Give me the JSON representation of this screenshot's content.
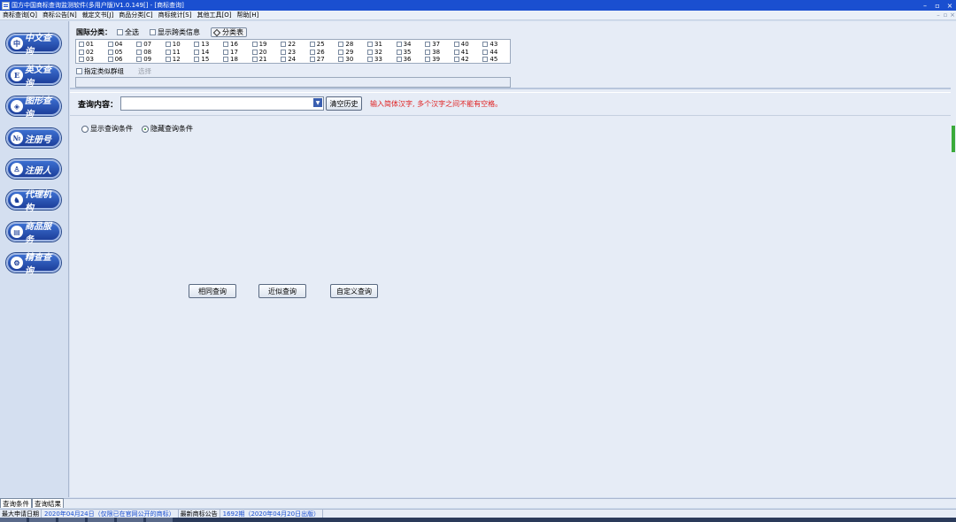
{
  "window": {
    "title": "国方中国商标查询监测软件(多用户版)V1.0.149[] - [商标查询]",
    "minimize": "–",
    "maximize": "▫",
    "close": "×"
  },
  "menu": [
    "商标查询[Q]",
    "商标公告[N]",
    "裁定文书[J]",
    "商品分类[C]",
    "商标统计[S]",
    "其他工具[O]",
    "帮助[H]"
  ],
  "sidebar": [
    {
      "label": "中文查询",
      "icon_glyph": "中"
    },
    {
      "label": "英文查询",
      "icon_glyph": "E"
    },
    {
      "label": "图形查询",
      "icon_glyph": "◈"
    },
    {
      "label": "注册号",
      "icon_glyph": "№"
    },
    {
      "label": "注册人",
      "icon_glyph": "♙"
    },
    {
      "label": "代理机构",
      "icon_glyph": "♞"
    },
    {
      "label": "商品服务",
      "icon_glyph": "▤"
    },
    {
      "label": "精查查询",
      "icon_glyph": "⚙"
    }
  ],
  "classification": {
    "label": "国际分类：",
    "select_all": "全选",
    "show_cross": "显示跨类信息",
    "classify_button": "分类表",
    "classes": [
      "01",
      "02",
      "03",
      "04",
      "05",
      "06",
      "07",
      "08",
      "09",
      "10",
      "11",
      "12",
      "13",
      "14",
      "15",
      "16",
      "17",
      "18",
      "19",
      "20",
      "21",
      "22",
      "23",
      "24",
      "25",
      "26",
      "27",
      "28",
      "29",
      "30",
      "31",
      "32",
      "33",
      "34",
      "35",
      "36",
      "37",
      "38",
      "39",
      "40",
      "41",
      "42",
      "43",
      "44",
      "45"
    ],
    "similar_group": "指定类似群组",
    "choose": "选择"
  },
  "query": {
    "label": "查询内容：",
    "value": "",
    "clear_history": "清空历史",
    "hint": "输入简体汉字, 多个汉字之间不能有空格。",
    "show_conditions": "显示查询条件",
    "hide_conditions": "隐藏查询条件",
    "selected_radio": "hide",
    "btn_same": "相同查询",
    "btn_similar": "近似查询",
    "btn_custom": "自定义查询"
  },
  "tabs": [
    "查询条件",
    "查询结果"
  ],
  "status": {
    "max_date_label": "最大申请日期",
    "max_date_value": "2020年04月24日（仅限已在官网公开的商标）",
    "latest_notice_label": "最新商标公告",
    "latest_notice_value": "1692期（2020年04月20日出版）"
  },
  "colors": {
    "titlebar": "#1a4fd0",
    "nav_button": "#1d3f9a",
    "hint_red": "#e02020",
    "scroll_thumb": "#3aaa3a"
  }
}
